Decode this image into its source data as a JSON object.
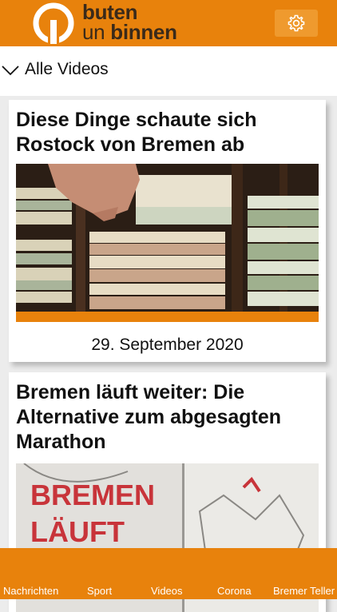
{
  "header": {
    "logo_line1": "buten",
    "logo_line2_prefix": "un ",
    "logo_line2_bold": "binnen",
    "settings_icon": "gear-icon"
  },
  "filter": {
    "label": "Alle Videos",
    "icon": "chevron-down-icon"
  },
  "videos": [
    {
      "title": "Diese Dinge schaute sich Rostock von Bremen ab",
      "thumbnail": "banknotes-in-cash-drawer",
      "date": "29. September 2020"
    },
    {
      "title": "Bremen läuft weiter: Die Alternative zum abgesagten Marathon",
      "thumbnail": "bremen-laeuft-sign",
      "thumb_text_line1": "BREMEN",
      "thumb_text_line2": "LÄUFT"
    }
  ],
  "bottom_nav": {
    "items": [
      {
        "label": "Nachrichten"
      },
      {
        "label": "Sport"
      },
      {
        "label": "Videos"
      },
      {
        "label": "Corona"
      },
      {
        "label": "Bremer Teller"
      }
    ]
  },
  "colors": {
    "brand_orange": "#e8820c",
    "logo_dark": "#3a2a1a",
    "background": "#ececec"
  }
}
